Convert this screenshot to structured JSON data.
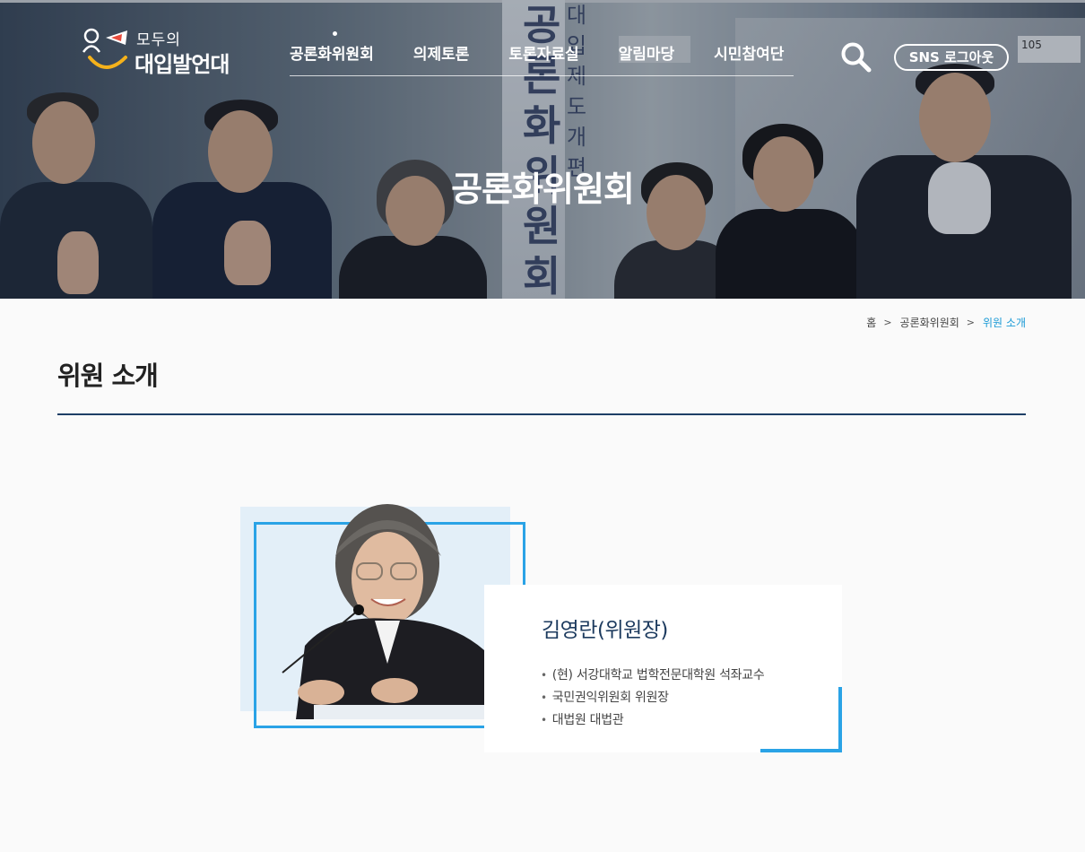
{
  "header": {
    "logo": {
      "top_text": "모두의",
      "main_text": "대입발언대"
    },
    "nav": [
      {
        "label": "공론화위원회",
        "active": true
      },
      {
        "label": "의제토론"
      },
      {
        "label": "토론자료실"
      },
      {
        "label": "알림마당"
      },
      {
        "label": "시민참여단"
      }
    ],
    "search_icon": "search-icon",
    "sns_logout_label": "SNS 로그아웃"
  },
  "hero": {
    "title": "공론화위원회",
    "banner_text": "공론화위원회",
    "banner_small_text": "대입제도개편",
    "sign_text": "105"
  },
  "breadcrumb": {
    "items": [
      "홈",
      "공론화위원회",
      "위원 소개"
    ]
  },
  "page": {
    "title": "위원 소개"
  },
  "member": {
    "name": "김영란(위원장)",
    "roles": [
      "(현) 서강대학교 법학전문대학원 석좌교수",
      "국민권익위원회 위원장",
      "대법원 대법관"
    ]
  },
  "colors": {
    "accent_blue": "#2aa3e6",
    "navy": "#1e3f66",
    "breadcrumb_current": "#1a9ad6",
    "logo_yellow": "#f5b21b"
  }
}
